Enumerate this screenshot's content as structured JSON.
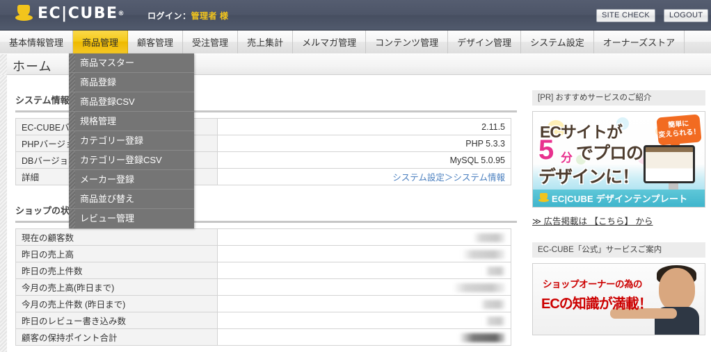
{
  "header": {
    "logo_text": "EC|CUBE",
    "logo_icon": "ec-cube-hat-icon",
    "login_prefix": "ログイン：",
    "login_user": "管理者 様",
    "site_check_label": "SITE CHECK",
    "logout_label": "LOGOUT"
  },
  "nav": {
    "tabs": [
      {
        "label": "基本情報管理",
        "active": false
      },
      {
        "label": "商品管理",
        "active": true
      },
      {
        "label": "顧客管理",
        "active": false
      },
      {
        "label": "受注管理",
        "active": false
      },
      {
        "label": "売上集計",
        "active": false
      },
      {
        "label": "メルマガ管理",
        "active": false
      },
      {
        "label": "コンテンツ管理",
        "active": false
      },
      {
        "label": "デザイン管理",
        "active": false
      },
      {
        "label": "システム設定",
        "active": false
      },
      {
        "label": "オーナーズストア",
        "active": false
      }
    ]
  },
  "dropdown": {
    "owner_tab": "商品管理",
    "items": [
      {
        "label": "商品マスター"
      },
      {
        "label": "商品登録"
      },
      {
        "label": "商品登録CSV"
      },
      {
        "label": "規格管理"
      },
      {
        "label": "カテゴリー登録"
      },
      {
        "label": "カテゴリー登録CSV"
      },
      {
        "label": "メーカー登録"
      },
      {
        "label": "商品並び替え"
      },
      {
        "label": "レビュー管理"
      }
    ]
  },
  "page": {
    "title": "ホーム"
  },
  "system_info": {
    "heading": "システム情報",
    "rows": [
      {
        "label": "EC-CUBEバージョン",
        "value": "2.11.5",
        "is_link": false
      },
      {
        "label": "PHPバージョン",
        "value": "PHP 5.3.3",
        "is_link": false
      },
      {
        "label": "DBバージョン",
        "value": "MySQL 5.0.95",
        "is_link": false
      },
      {
        "label": "詳細",
        "value": "システム設定＞システム情報",
        "is_link": true
      }
    ]
  },
  "shop_status": {
    "heading": "ショップの状況",
    "rows": [
      {
        "label": "現在の顧客数",
        "value": "",
        "redacted": true,
        "redact_width": 46,
        "redact_dark": false
      },
      {
        "label": "昨日の売上高",
        "value": "",
        "redacted": true,
        "redact_width": 62,
        "redact_dark": false
      },
      {
        "label": "昨日の売上件数",
        "value": "",
        "redacted": true,
        "redact_width": 29,
        "redact_dark": false
      },
      {
        "label": "今月の売上高(昨日まで)",
        "value": "",
        "redacted": true,
        "redact_width": 75,
        "redact_dark": false
      },
      {
        "label": "今月の売上件数 (昨日まで)",
        "value": "",
        "redacted": true,
        "redact_width": 36,
        "redact_dark": false
      },
      {
        "label": "昨日のレビュー書き込み数",
        "value": "",
        "redacted": true,
        "redact_width": 29,
        "redact_dark": false
      },
      {
        "label": "顧客の保持ポイント合計",
        "value": "",
        "redacted": true,
        "redact_width": 66,
        "redact_dark": true
      }
    ]
  },
  "sidebar": {
    "pr_heading": "[PR] おすすめサービスのご紹介",
    "pr_banner": {
      "line1": "ECサイトが",
      "big_number": "5",
      "unit": "分",
      "line2_rest": "でプロの",
      "line3": "デザインに！",
      "balloon_line1": "簡単に",
      "balloon_line2": "変えられる！",
      "strip_text": "EC|CUBE デザインテンプレート",
      "strip_icon": "ec-cube-hat-icon"
    },
    "ad_link": "≫ 広告掲載は 【こちら】 から",
    "official_heading": "EC-CUBE「公式」サービスご案内",
    "official_banner": {
      "line1": "ショップオーナーの為の",
      "line2": "ECの知識が満載！"
    }
  },
  "colors": {
    "header_bg": "#4d5568",
    "accent_gold": "#f2c41c",
    "active_tab": "#f5c919",
    "dropdown_bg": "#757575",
    "link_blue": "#4a7fbf",
    "banner_cyan": "#3fb5cc",
    "banner_red": "#cc0000",
    "banner_pink": "#e8318e",
    "balloon_orange": "#f26b21"
  }
}
